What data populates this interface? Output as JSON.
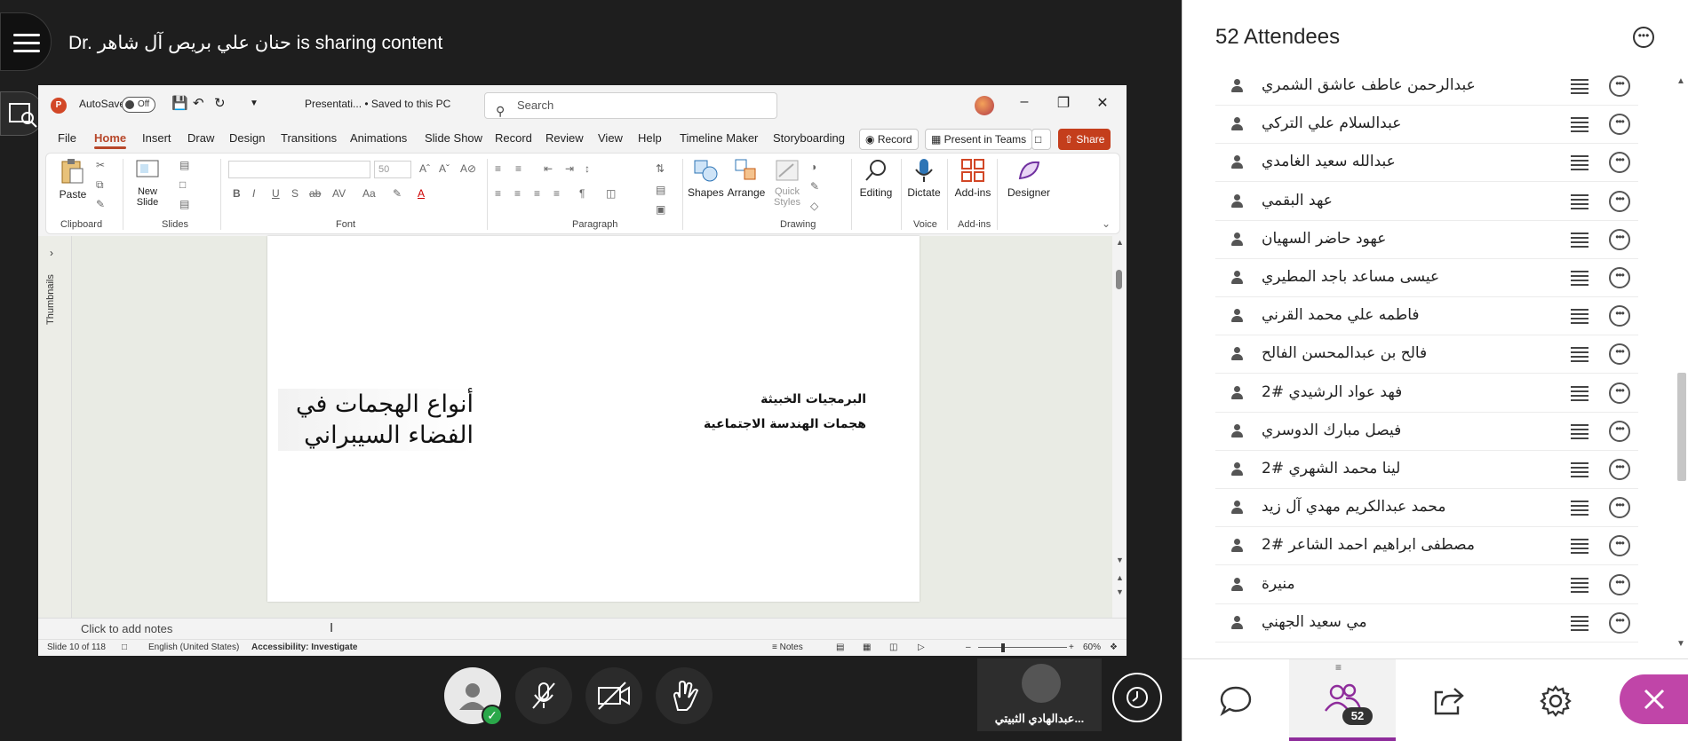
{
  "share": {
    "presenter_name": "حنان علي بريص آل شاهر",
    "prefix": "Dr.",
    "suffix": "is sharing content"
  },
  "ppt": {
    "autosave_label": "AutoSave",
    "autosave_state": "Off",
    "file_title": "Presentati... • Saved to this PC",
    "search_placeholder": "Search",
    "tabs": [
      "File",
      "Home",
      "Insert",
      "Draw",
      "Design",
      "Transitions",
      "Animations",
      "Slide Show",
      "Record",
      "Review",
      "View",
      "Help",
      "Timeline Maker",
      "Storyboarding"
    ],
    "active_tab": "Home",
    "record_btn": "Record",
    "present_teams_btn": "Present in Teams",
    "share_btn": "Share",
    "ribbon": {
      "paste": "Paste",
      "new_slide": "New Slide",
      "font_size": "50",
      "shapes": "Shapes",
      "arrange": "Arrange",
      "quick_styles": "Quick Styles",
      "editing": "Editing",
      "dictate": "Dictate",
      "add_ins": "Add-ins",
      "designer": "Designer",
      "groups": {
        "clipboard": "Clipboard",
        "slides": "Slides",
        "font": "Font",
        "paragraph": "Paragraph",
        "drawing": "Drawing",
        "voice": "Voice",
        "add_ins": "Add-ins"
      }
    },
    "thumbnails_label": "Thumbnails",
    "slide": {
      "title_line1": "أنواع الهجمات في",
      "title_line2": "الفضاء السيبراني",
      "bullet1": "البرمجيات الخبيثة",
      "bullet2": "هجمات الهندسة الاجتماعية"
    },
    "notes_placeholder": "Click to add notes",
    "status": {
      "slide_info": "Slide 10 of 118",
      "language": "English (United States)",
      "accessibility": "Accessibility: Investigate",
      "notes": "Notes",
      "zoom": "60%"
    }
  },
  "bottom_bar": {
    "speaker_name": "عبدالهادي الثبيتي..."
  },
  "panel": {
    "title": "52 Attendees",
    "attendees": [
      "عبدالرحمن عاطف عاشق الشمري",
      "عبدالسلام علي التركي",
      "عبدالله سعيد الغامدي",
      "عهد البقمي",
      "عهود حاضر السهيان",
      "عيسى مساعد باجد المطيري",
      "فاطمه علي محمد القرني",
      "فالح بن عبدالمحسن الفالح",
      "فهد عواد الرشيدي #2",
      "فيصل مبارك الدوسري",
      "لينا محمد الشهري #2",
      "محمد عبدالكريم مهدي آل زيد",
      "مصطفى ابراهيم احمد الشاعر #2",
      "منيرة",
      "مي سعيد الجهني"
    ],
    "people_count": "52"
  }
}
